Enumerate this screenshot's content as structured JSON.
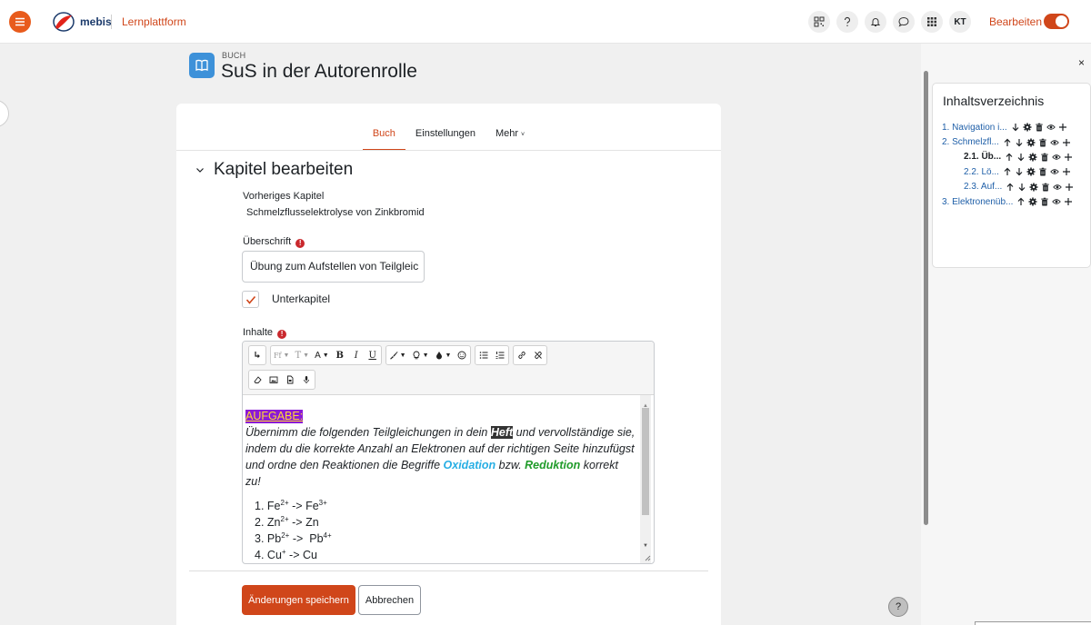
{
  "navbar": {
    "logo_text": "mebis",
    "nav_link": "Lernplattform",
    "avatar_initials": "KT",
    "edit_mode_label": "Bearbeiten",
    "icons": [
      "qr-code-icon",
      "help-icon",
      "bell-icon",
      "chat-icon",
      "grid-icon"
    ],
    "accent_color": "#d0461a"
  },
  "page": {
    "pretitle": "BUCH",
    "title": "SuS in der Autorenrolle"
  },
  "tabs": [
    {
      "label": "Buch",
      "active": true
    },
    {
      "label": "Einstellungen",
      "active": false
    },
    {
      "label": "Mehr",
      "active": false
    }
  ],
  "form": {
    "section_title": "Kapitel bearbeiten",
    "previous_chapter_label": "Vorheriges Kapitel",
    "previous_chapter_value": "Schmelzflusselektrolyse von Zinkbromid",
    "heading_label": "Überschrift",
    "heading_value": "Übung zum Aufstellen von Teilgleic",
    "subchapter_label": "Unterkapitel",
    "subchapter_checked": true,
    "content_label": "Inhalte",
    "required_symbol": "!",
    "save_button": "Änderungen speichern",
    "cancel_button": "Abbrechen"
  },
  "editor": {
    "toolbar_labels": {
      "font": "Ff",
      "font_size": "T",
      "text_style": "A",
      "bold": "B",
      "italic": "I",
      "underline": "U"
    },
    "content": {
      "tag": "AUFGABE:",
      "text_part1": "Übernimm die folgenden Teilgleichungen in dein ",
      "highlight_word": "Heft",
      "text_part2": " und vervollständige sie, indem du die korrekte Anzahl an Elektronen auf der richtigen Seite hinzufügst und ordne den Reaktionen die Begriffe ",
      "term_oxidation": "Oxidation",
      "text_bzw": " bzw. ",
      "term_reduction": "Reduktion",
      "text_end": " korrekt zu!",
      "equations": [
        {
          "num": "1.",
          "a": "Fe",
          "a_sup": "2+",
          "arrow": " -> ",
          "b": "Fe",
          "b_sup": "3+"
        },
        {
          "num": "2.",
          "a": "Zn",
          "a_sup": "2+",
          "arrow": " -> ",
          "b": "Zn",
          "b_sup": ""
        },
        {
          "num": "3.",
          "a": "Pb",
          "a_sup": "2+",
          "arrow": " ->  ",
          "b": "Pb",
          "b_sup": "4+"
        },
        {
          "num": "4.",
          "a": "Cu",
          "a_sup": "+",
          "arrow": " -> ",
          "b": "Cu",
          "b_sup": ""
        }
      ],
      "colors": {
        "tag_bg": "#8b1ad6",
        "tag_fg": "#ffd733",
        "oxidation": "#27aee4",
        "reduction": "#209b2a"
      }
    }
  },
  "drawer": {
    "close_symbol": "×",
    "toc_title": "Inhaltsverzeichnis",
    "items": [
      {
        "label": "1. Navigation i...",
        "level": 0,
        "current": false,
        "up": false,
        "down": true
      },
      {
        "label": "2. Schmelzfl...",
        "level": 0,
        "current": false,
        "up": true,
        "down": true
      },
      {
        "label": "2.1. Üb...",
        "level": 1,
        "current": true,
        "up": true,
        "down": true
      },
      {
        "label": "2.2. Lö...",
        "level": 1,
        "current": false,
        "up": true,
        "down": true
      },
      {
        "label": "2.3. Auf...",
        "level": 1,
        "current": false,
        "up": true,
        "down": true
      },
      {
        "label": "3. Elektronenüb...",
        "level": 0,
        "current": false,
        "up": true,
        "down": false
      }
    ]
  },
  "help_symbol": "?"
}
